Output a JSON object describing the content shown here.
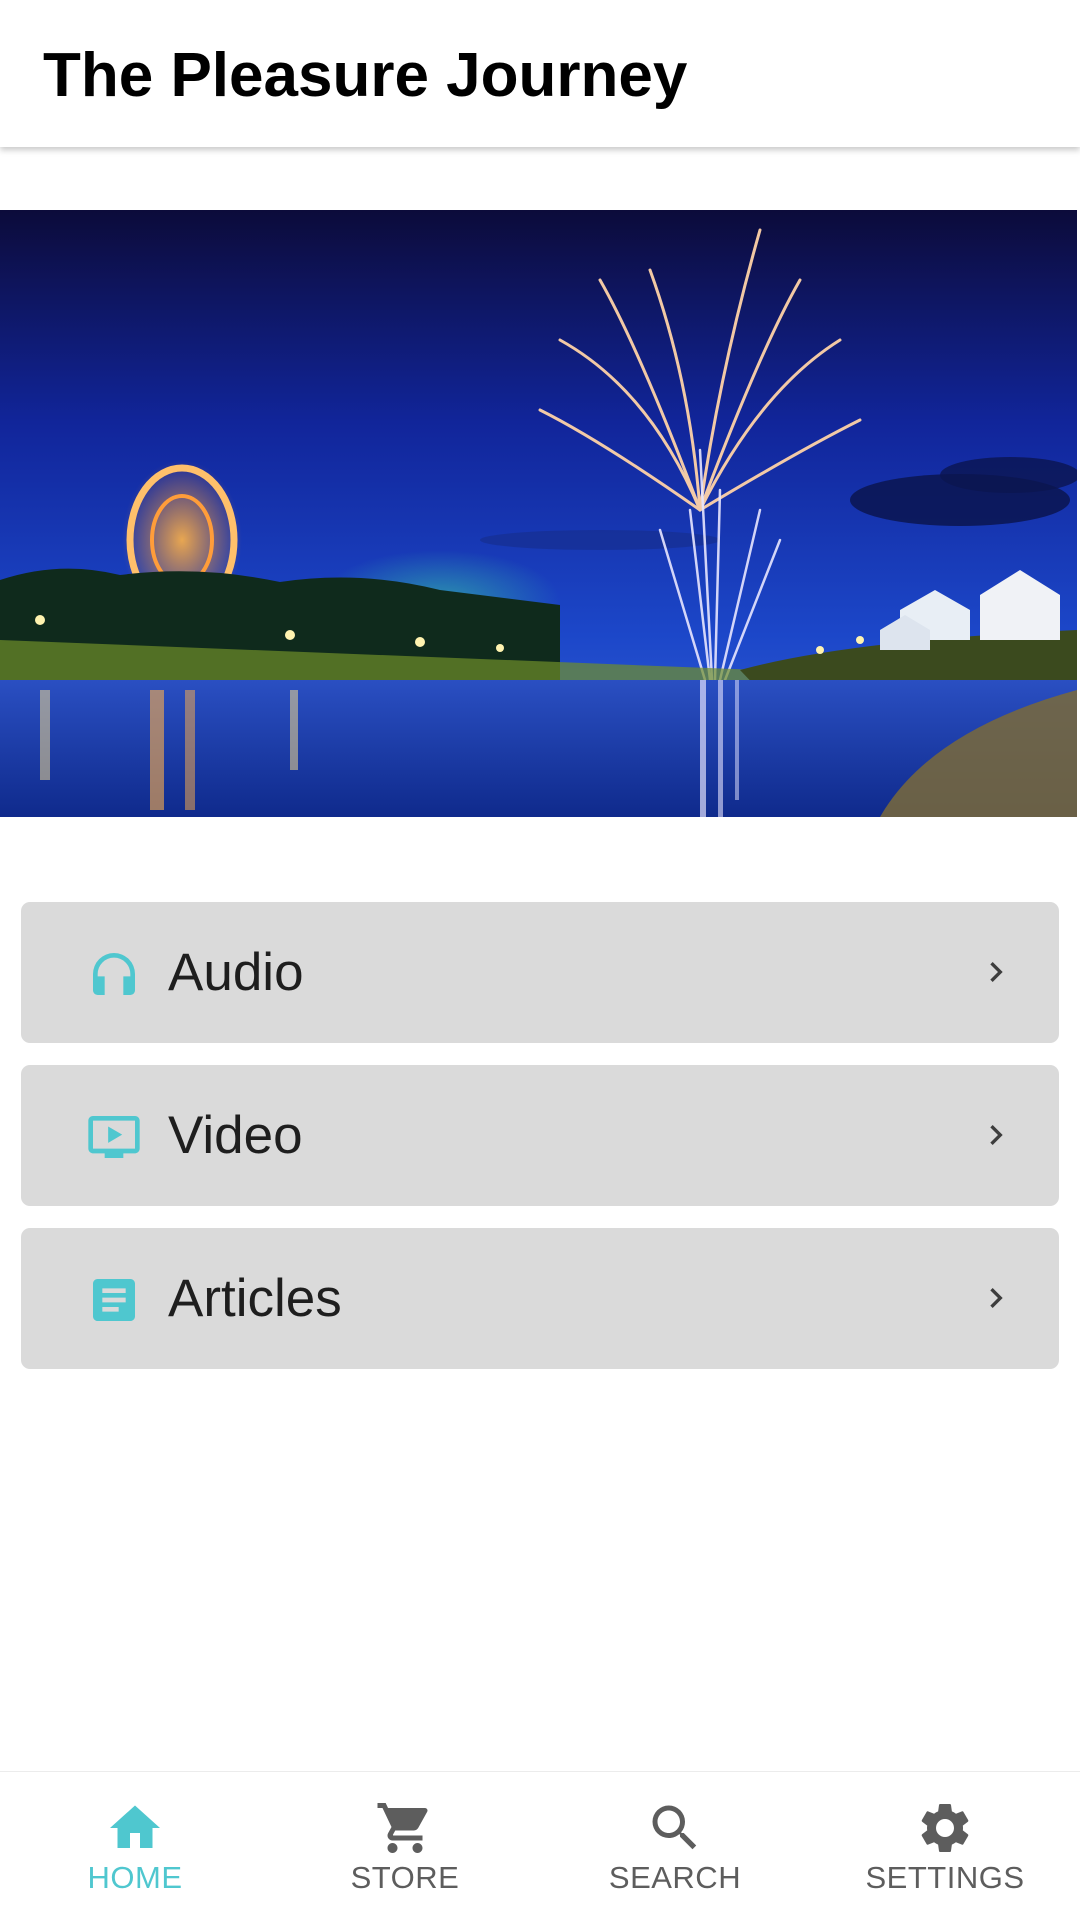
{
  "app": {
    "title": "The Pleasure Journey"
  },
  "colors": {
    "accent": "#4fc7cf",
    "card_bg": "#dadada",
    "nav_inactive": "#5d5d5d"
  },
  "hero": {
    "icon": "fireworks-photo"
  },
  "menu": [
    {
      "label": "Audio",
      "icon": "headphones-icon"
    },
    {
      "label": "Video",
      "icon": "tv-play-icon"
    },
    {
      "label": "Articles",
      "icon": "article-icon"
    }
  ],
  "bottom_nav": [
    {
      "label": "HOME",
      "icon": "home-icon",
      "active": true
    },
    {
      "label": "STORE",
      "icon": "cart-icon",
      "active": false
    },
    {
      "label": "SEARCH",
      "icon": "search-icon",
      "active": false
    },
    {
      "label": "SETTINGS",
      "icon": "gear-icon",
      "active": false
    }
  ]
}
